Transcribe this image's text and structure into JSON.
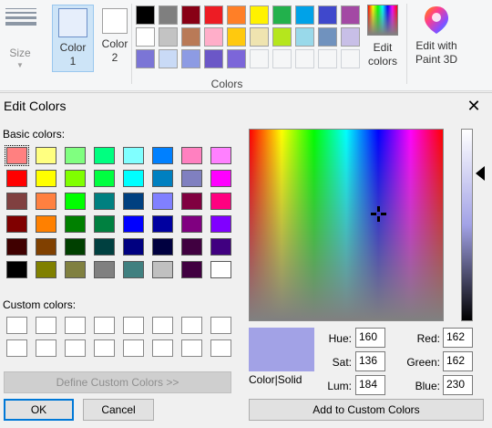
{
  "ribbon": {
    "size_label": "Size",
    "color1_label": "Color 1",
    "color2_label": "Color 2",
    "color1_value": "#e6eefb",
    "color2_value": "#ffffff",
    "group_label": "Colors",
    "edit_colors_label": "Edit colors",
    "paint3d_label": "Edit with Paint 3D",
    "palette": [
      [
        "#000000",
        "#7f7f7f",
        "#880015",
        "#ed1c24",
        "#ff7f27",
        "#fff200",
        "#22b14c",
        "#00a2e8",
        "#3f48cc",
        "#a349a4"
      ],
      [
        "#ffffff",
        "#c3c3c3",
        "#b97a57",
        "#ffaec9",
        "#ffc90e",
        "#efe4b0",
        "#b5e61d",
        "#99d9ea",
        "#7092be",
        "#c8bfe7"
      ],
      [
        "#7b75d6",
        "#c9daf6",
        "#8d9be3",
        "#6b57c7",
        "#7c66d9",
        "#f5f6f7",
        "#f5f6f7",
        "#f5f6f7",
        "#f5f6f7",
        "#f5f6f7"
      ]
    ]
  },
  "dialog": {
    "title": "Edit Colors",
    "basic_label": "Basic colors:",
    "custom_label": "Custom colors:",
    "basic_colors": [
      [
        "#ff8080",
        "#ffff80",
        "#80ff80",
        "#00ff80",
        "#80ffff",
        "#0080ff",
        "#ff80c0",
        "#ff80ff"
      ],
      [
        "#ff0000",
        "#ffff00",
        "#80ff00",
        "#00ff40",
        "#00ffff",
        "#0080c0",
        "#8080c0",
        "#ff00ff"
      ],
      [
        "#804040",
        "#ff8040",
        "#00ff00",
        "#008080",
        "#004080",
        "#8080ff",
        "#800040",
        "#ff0080"
      ],
      [
        "#800000",
        "#ff8000",
        "#008000",
        "#008040",
        "#0000ff",
        "#0000a0",
        "#800080",
        "#8000ff"
      ],
      [
        "#400000",
        "#804000",
        "#004000",
        "#004040",
        "#000080",
        "#000040",
        "#400040",
        "#400080"
      ],
      [
        "#000000",
        "#808000",
        "#808040",
        "#808080",
        "#408080",
        "#c0c0c0",
        "#400040",
        "#ffffff"
      ]
    ],
    "define_btn": "Define Custom Colors >>",
    "ok_btn": "OK",
    "cancel_btn": "Cancel",
    "preview_label": "Color|Solid",
    "preview_color": "#a2a2e6",
    "add_btn": "Add to Custom Colors",
    "fields": {
      "hue_label": "Hue:",
      "hue": "160",
      "sat_label": "Sat:",
      "sat": "136",
      "lum_label": "Lum:",
      "lum": "184",
      "red_label": "Red:",
      "red": "162",
      "green_label": "Green:",
      "green": "162",
      "blue_label": "Blue:",
      "blue": "230"
    }
  }
}
